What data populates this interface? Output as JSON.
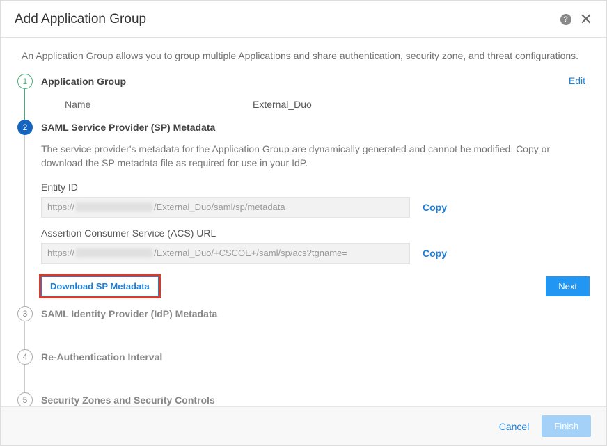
{
  "header": {
    "title": "Add Application Group"
  },
  "intro": "An Application Group allows you to group multiple Applications and share authentication, security zone, and threat configurations.",
  "steps": {
    "s1": {
      "num": "1",
      "title": "Application Group",
      "name_label": "Name",
      "name_value": "External_Duo",
      "edit_label": "Edit"
    },
    "s2": {
      "num": "2",
      "title": "SAML Service Provider (SP) Metadata",
      "desc": "The service provider's metadata for the Application Group are dynamically generated and cannot be modified. Copy or download the SP metadata file as required for use in your IdP.",
      "entity_id_label": "Entity ID",
      "entity_id_prefix": "https://",
      "entity_id_suffix": "/External_Duo/saml/sp/metadata",
      "acs_label": "Assertion Consumer Service (ACS) URL",
      "acs_prefix": "https://",
      "acs_suffix": "/External_Duo/+CSCOE+/saml/sp/acs?tgname=",
      "copy_label": "Copy",
      "download_label": "Download SP Metadata",
      "next_label": "Next"
    },
    "s3": {
      "num": "3",
      "title": "SAML Identity Provider (IdP) Metadata"
    },
    "s4": {
      "num": "4",
      "title": "Re-Authentication Interval"
    },
    "s5": {
      "num": "5",
      "title": "Security Zones and Security Controls"
    }
  },
  "footer": {
    "cancel_label": "Cancel",
    "finish_label": "Finish"
  }
}
